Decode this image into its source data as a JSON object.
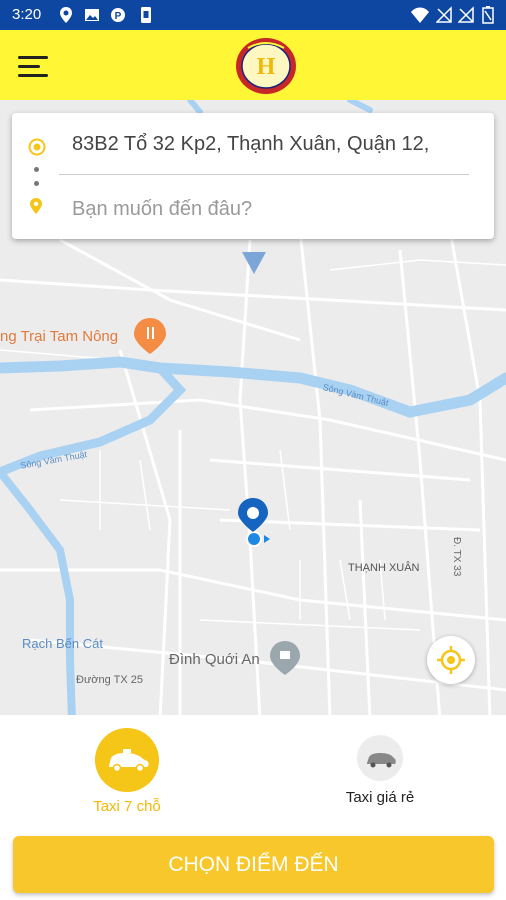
{
  "status_bar": {
    "time": "3:20",
    "left_icons": [
      "location-icon",
      "image-icon",
      "parking-icon",
      "sim-icon"
    ],
    "right_icons": [
      "wifi-icon",
      "signal-off-icon",
      "signal-off-icon",
      "battery-icon"
    ]
  },
  "header": {
    "menu_icon": "hamburger-menu-icon",
    "logo": "company-logo"
  },
  "search": {
    "origin_address": "83B2 Tổ 32 Kp2, Thạnh Xuân, Quận 12,",
    "destination_placeholder": "Bạn muốn đến đâu?"
  },
  "map": {
    "labels": {
      "farm": "ng Trại Tam Nông",
      "river_1": "Sông Vàm Thuật",
      "river_2": "Sông Vàm Thuật",
      "district": "THẠNH XUÂN",
      "road_right": "Đ. TX 33",
      "canal": "Rạch Bến Cát",
      "temple": "Đình Quới An",
      "road_bottom": "Đường TX 25"
    }
  },
  "vehicle_options": [
    {
      "label": "Taxi 7 chỗ",
      "selected": true,
      "icon": "taxi-car-icon"
    },
    {
      "label": "Taxi giá rẻ",
      "selected": false,
      "icon": "car-icon"
    }
  ],
  "cta": {
    "label": "CHỌN ĐIỂM ĐẾN"
  },
  "colors": {
    "status_bar": "#0d47a1",
    "header": "#fff635",
    "accent": "#f5c518",
    "cta": "#f7c72b",
    "user_location": "#1565c0",
    "water": "#a9d1f2"
  }
}
